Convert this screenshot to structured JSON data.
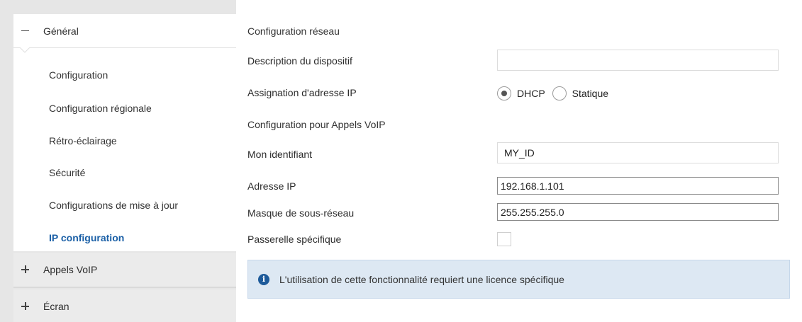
{
  "sidebar": {
    "general": {
      "label": "Général",
      "expanded": true
    },
    "items": [
      {
        "label": "Configuration"
      },
      {
        "label": "Configuration régionale"
      },
      {
        "label": "Rétro-éclairage"
      },
      {
        "label": "Sécurité"
      },
      {
        "label": "Configurations de mise à jour"
      },
      {
        "label": "IP configuration",
        "active": true
      }
    ],
    "groups": [
      {
        "label": "Appels VoIP",
        "expanded": false
      },
      {
        "label": "Écran",
        "expanded": false
      }
    ]
  },
  "main": {
    "network_section": "Configuration réseau",
    "device_description": {
      "label": "Description du dispositif",
      "value": ""
    },
    "ip_assignment": {
      "label": "Assignation d'adresse IP",
      "options": [
        "DHCP",
        "Statique"
      ],
      "selected": "DHCP"
    },
    "voip_section": "Configuration pour Appels VoIP",
    "my_id": {
      "label": "Mon identifiant",
      "value": "MY_ID"
    },
    "ip_address": {
      "label": "Adresse IP",
      "value": "192.168.1.101"
    },
    "subnet_mask": {
      "label": "Masque de sous-réseau",
      "value": "255.255.255.0"
    },
    "specific_gateway": {
      "label": "Passerelle spécifique",
      "checked": false
    },
    "info": {
      "icon": "info-icon",
      "text": "L'utilisation de cette fonctionnalité requiert une licence spécifique"
    }
  },
  "colors": {
    "accent": "#1a5fa6",
    "sidebar_bg": "#e6e6e6",
    "info_bg": "#dde8f3",
    "info_icon": "#1d5a9a"
  }
}
